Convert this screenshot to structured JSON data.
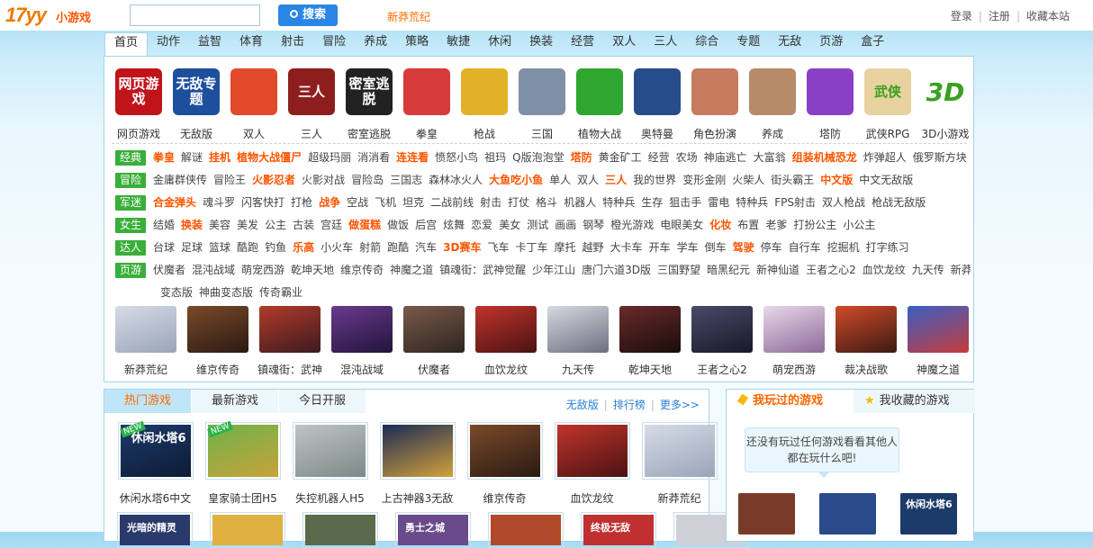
{
  "header": {
    "logo_main": "17yy",
    "logo_sub": "小游戏",
    "search_placeholder": "",
    "search_button": "搜索",
    "hot_keyword": "新莽荒纪",
    "links": [
      "登录",
      "注册",
      "收藏本站"
    ]
  },
  "nav": [
    "首页",
    "动作",
    "益智",
    "体育",
    "射击",
    "冒险",
    "养成",
    "策略",
    "敏捷",
    "休闲",
    "换装",
    "经营",
    "双人",
    "三人",
    "综合",
    "专题",
    "无敌",
    "页游",
    "盒子"
  ],
  "categories": [
    {
      "label": "网页游戏",
      "icon_text": "网页游戏",
      "color": "#c0141a"
    },
    {
      "label": "无敌版",
      "icon_text": "无敌专题",
      "color": "#1d4f9c"
    },
    {
      "label": "双人",
      "icon_text": "",
      "color": "#e24a2b"
    },
    {
      "label": "三人",
      "icon_text": "三人",
      "color": "#8e1e1e"
    },
    {
      "label": "密室逃脱",
      "icon_text": "密室逃脱",
      "color": "#222222"
    },
    {
      "label": "拳皇",
      "icon_text": "",
      "color": "#d73a3a"
    },
    {
      "label": "枪战",
      "icon_text": "",
      "color": "#e2b126"
    },
    {
      "label": "三国",
      "icon_text": "",
      "color": "#7f8fa6"
    },
    {
      "label": "植物大战",
      "icon_text": "",
      "color": "#2fa630"
    },
    {
      "label": "奥特曼",
      "icon_text": "",
      "color": "#274c8a"
    },
    {
      "label": "角色扮演",
      "icon_text": "",
      "color": "#c77b5f"
    },
    {
      "label": "养成",
      "icon_text": "",
      "color": "#b78a6a"
    },
    {
      "label": "塔防",
      "icon_text": "",
      "color": "#8a3fc7"
    },
    {
      "label": "武侠RPG",
      "icon_text": "武侠",
      "color": "#e8d2a0"
    },
    {
      "label": "3D小游戏",
      "icon_text": "3D",
      "color": "#ffffff"
    }
  ],
  "tag_rows": [
    {
      "tag": "经典",
      "items": [
        [
          "拳皇",
          1
        ],
        [
          "解谜",
          0
        ],
        [
          "挂机",
          1
        ],
        [
          "植物大战僵尸",
          1
        ],
        [
          "超级玛丽",
          0
        ],
        [
          "消消看",
          0
        ],
        [
          "连连看",
          1
        ],
        [
          "愤怒小鸟",
          0
        ],
        [
          "祖玛",
          0
        ],
        [
          "Q版泡泡堂",
          0
        ],
        [
          "塔防",
          1
        ],
        [
          "黄金矿工",
          0
        ],
        [
          "经营",
          0
        ],
        [
          "农场",
          0
        ],
        [
          "神庙逃亡",
          0
        ],
        [
          "大富翁",
          0
        ],
        [
          "组装机械恐龙",
          1
        ],
        [
          "炸弹超人",
          0
        ],
        [
          "俄罗斯方块",
          0
        ]
      ]
    },
    {
      "tag": "冒险",
      "items": [
        [
          "金庸群侠传",
          0
        ],
        [
          "冒险王",
          0
        ],
        [
          "火影忍者",
          1
        ],
        [
          "火影对战",
          0
        ],
        [
          "冒险岛",
          0
        ],
        [
          "三国志",
          0
        ],
        [
          "森林冰火人",
          0
        ],
        [
          "大鱼吃小鱼",
          1
        ],
        [
          "单人",
          0
        ],
        [
          "双人",
          0
        ],
        [
          "三人",
          1
        ],
        [
          "我的世界",
          0
        ],
        [
          "变形金刚",
          0
        ],
        [
          "火柴人",
          0
        ],
        [
          "街头霸王",
          0
        ],
        [
          "中文版",
          1
        ],
        [
          "中文无敌版",
          0
        ]
      ]
    },
    {
      "tag": "军迷",
      "items": [
        [
          "合金弹头",
          1
        ],
        [
          "魂斗罗",
          0
        ],
        [
          "闪客快打",
          0
        ],
        [
          "打枪",
          0
        ],
        [
          "战争",
          1
        ],
        [
          "空战",
          0
        ],
        [
          "飞机",
          0
        ],
        [
          "坦克",
          0
        ],
        [
          "二战前线",
          0
        ],
        [
          "射击",
          0
        ],
        [
          "打仗",
          0
        ],
        [
          "格斗",
          0
        ],
        [
          "机器人",
          0
        ],
        [
          "特种兵",
          0
        ],
        [
          "生存",
          0
        ],
        [
          "狙击手",
          0
        ],
        [
          "雷电",
          0
        ],
        [
          "特种兵",
          0
        ],
        [
          "FPS射击",
          0
        ],
        [
          "双人枪战",
          0
        ],
        [
          "枪战无敌版",
          0
        ]
      ]
    },
    {
      "tag": "女生",
      "items": [
        [
          "结婚",
          0
        ],
        [
          "换装",
          1
        ],
        [
          "美容",
          0
        ],
        [
          "美发",
          0
        ],
        [
          "公主",
          0
        ],
        [
          "古装",
          0
        ],
        [
          "宫廷",
          0
        ],
        [
          "做蛋糕",
          1
        ],
        [
          "做饭",
          0
        ],
        [
          "后宫",
          0
        ],
        [
          "炫舞",
          0
        ],
        [
          "恋爱",
          0
        ],
        [
          "美女",
          0
        ],
        [
          "测试",
          0
        ],
        [
          "画画",
          0
        ],
        [
          "钢琴",
          0
        ],
        [
          "橙光游戏",
          0
        ],
        [
          "电眼美女",
          0
        ],
        [
          "化妆",
          1
        ],
        [
          "布置",
          0
        ],
        [
          "老爹",
          0
        ],
        [
          "打扮公主",
          0
        ],
        [
          "小公主",
          0
        ]
      ]
    },
    {
      "tag": "达人",
      "items": [
        [
          "台球",
          0
        ],
        [
          "足球",
          0
        ],
        [
          "篮球",
          0
        ],
        [
          "酷跑",
          0
        ],
        [
          "钓鱼",
          0
        ],
        [
          "乐高",
          1
        ],
        [
          "小火车",
          0
        ],
        [
          "射箭",
          0
        ],
        [
          "跑酷",
          0
        ],
        [
          "汽车",
          0
        ],
        [
          "3D赛车",
          1
        ],
        [
          "飞车",
          0
        ],
        [
          "卡丁车",
          0
        ],
        [
          "摩托",
          0
        ],
        [
          "越野",
          0
        ],
        [
          "大卡车",
          0
        ],
        [
          "开车",
          0
        ],
        [
          "学车",
          0
        ],
        [
          "倒车",
          0
        ],
        [
          "驾驶",
          1
        ],
        [
          "停车",
          0
        ],
        [
          "自行车",
          0
        ],
        [
          "挖掘机",
          0
        ],
        [
          "打字练习",
          0
        ]
      ]
    },
    {
      "tag": "页游",
      "items": [
        [
          "伏魔者",
          0
        ],
        [
          "混沌战域",
          0
        ],
        [
          "萌宠西游",
          0
        ],
        [
          "乾坤天地",
          0
        ],
        [
          "维京传奇",
          0
        ],
        [
          "神魔之道",
          0
        ],
        [
          "镇魂街：武神觉醒",
          0
        ],
        [
          "少年江山",
          0
        ],
        [
          "唐门六道3D版",
          0
        ],
        [
          "三国野望",
          0
        ],
        [
          "暗黑纪元",
          0
        ],
        [
          "新神仙道",
          0
        ],
        [
          "王者之心2",
          0
        ],
        [
          "血饮龙纹",
          0
        ],
        [
          "九天传",
          0
        ],
        [
          "新莽荒纪",
          0
        ]
      ]
    }
  ],
  "tag_row_continuation": [
    "变态版",
    "神曲变态版",
    "传奇霸业"
  ],
  "featured_games": [
    {
      "label": "新莽荒纪",
      "c1": "#d7dbe6",
      "c2": "#9aa5b9"
    },
    {
      "label": "维京传奇",
      "c1": "#7a4a2a",
      "c2": "#2a1a12"
    },
    {
      "label": "镇魂街：武神",
      "c1": "#b33b2a",
      "c2": "#3b1a20"
    },
    {
      "label": "混沌战域",
      "c1": "#6a3a8f",
      "c2": "#22143a"
    },
    {
      "label": "伏魔者",
      "c1": "#7a5a4a",
      "c2": "#2d2520"
    },
    {
      "label": "血饮龙纹",
      "c1": "#c1342c",
      "c2": "#4a1212"
    },
    {
      "label": "九天传",
      "c1": "#d6d9e0",
      "c2": "#6c7080"
    },
    {
      "label": "乾坤天地",
      "c1": "#6a2a2a",
      "c2": "#1a0c0c"
    },
    {
      "label": "王者之心2",
      "c1": "#4a4a6a",
      "c2": "#181828"
    },
    {
      "label": "萌宠西游",
      "c1": "#e8d8ea",
      "c2": "#8e6a9a"
    },
    {
      "label": "裁决战歌",
      "c1": "#d14a2a",
      "c2": "#3a1a12"
    },
    {
      "label": "神魔之道",
      "c1": "#3b5fc4",
      "c2": "#c43b3b"
    }
  ],
  "bottom": {
    "tabs": [
      "热门游戏",
      "最新游戏",
      "今日开服"
    ],
    "links": [
      "无敌版",
      "排行榜",
      "更多>>"
    ],
    "cards": [
      {
        "label": "休闲水塔6中文",
        "new": "NEW",
        "text": "休闲水塔6",
        "c1": "#1c3a6a",
        "c2": "#0d1b35"
      },
      {
        "label": "皇家骑士团H5",
        "new": "NEW",
        "text": "",
        "c1": "#6db34a",
        "c2": "#c9a23a"
      },
      {
        "label": "失控机器人H5",
        "new": "",
        "text": "",
        "c1": "#bfc4c4",
        "c2": "#7e8888"
      },
      {
        "label": "上古神器3无敌",
        "new": "",
        "text": "",
        "c1": "#1b2a55",
        "c2": "#d4a13b"
      },
      {
        "label": "维京传奇",
        "new": "",
        "text": "",
        "c1": "#7a4a2a",
        "c2": "#2a1a12"
      },
      {
        "label": "血饮龙纹",
        "new": "",
        "text": "",
        "c1": "#c1342c",
        "c2": "#4a1212"
      },
      {
        "label": "新莽荒纪",
        "new": "",
        "text": "",
        "c1": "#d7dbe6",
        "c2": "#9aa5b9"
      }
    ],
    "cards_row2_text": [
      "光暗的精灵",
      "",
      "",
      "勇士之城",
      "",
      "终极无敌",
      ""
    ]
  },
  "right_panel": {
    "tab_played": "我玩过的游戏",
    "tab_fav": "我收藏的游戏",
    "note": "还没有玩过任何游戏看看其他人都在玩什么吧!",
    "thumb_text": [
      "",
      "",
      "休闲水塔6"
    ]
  }
}
